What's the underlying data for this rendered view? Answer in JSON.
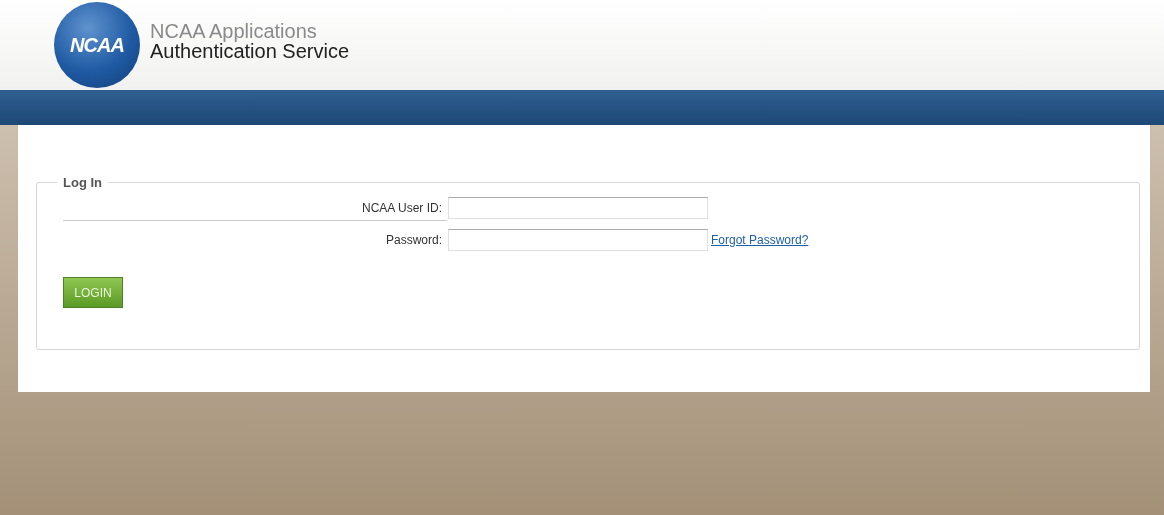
{
  "header": {
    "logo_text": "NCAA",
    "title_line_1": "NCAA Applications",
    "title_line_2": "Authentication Service"
  },
  "login_form": {
    "legend": "Log In",
    "fields": [
      {
        "label": "NCAA User ID:"
      },
      {
        "label": "Password:",
        "link": "Forgot Password?"
      }
    ],
    "button": "LOGIN"
  }
}
